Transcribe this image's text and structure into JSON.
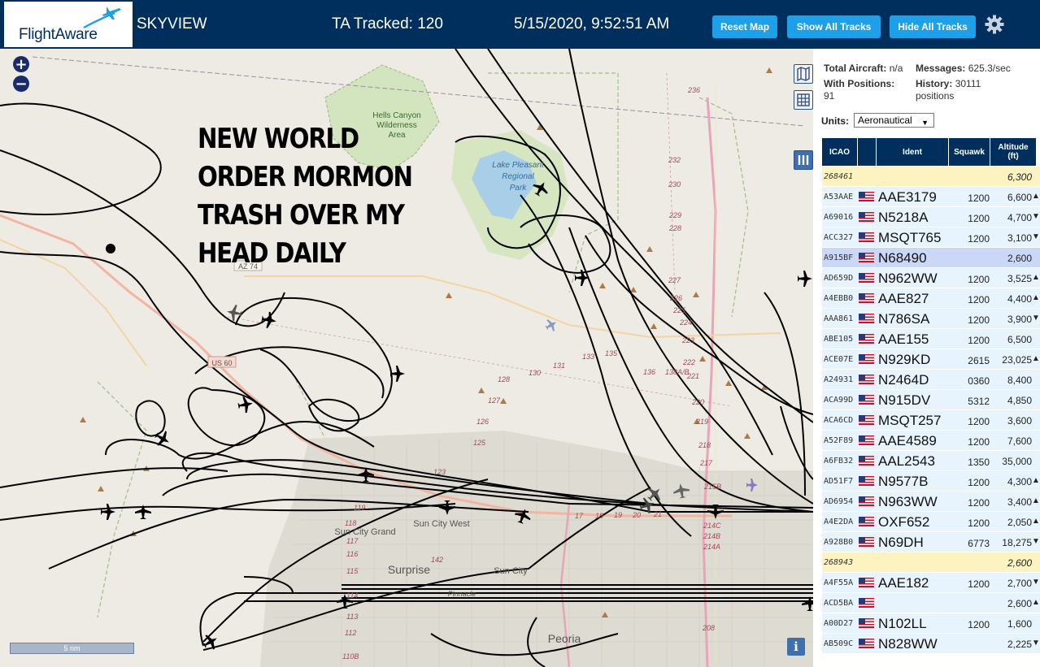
{
  "header": {
    "logo": "FlightAware",
    "app_title": "SKYVIEW",
    "ta_tracked": "TA Tracked: 120",
    "datetime": "5/15/2020, 9:52:51 AM",
    "reset_map": "Reset Map",
    "show_all_tracks": "Show All Tracks",
    "hide_all_tracks": "Hide All Tracks",
    "settings_icon": "gear-icon"
  },
  "map": {
    "zoom_in": "+",
    "zoom_out": "−",
    "overlay_lines": [
      "NEW WORLD",
      "ORDER MORMON",
      "TRASH OVER MY",
      "HEAD DAILY"
    ],
    "scale": "5 nm",
    "info": "i",
    "labels": {
      "hells_canyon": "Hells Canyon",
      "wilderness": "Wilderness",
      "area": "Area",
      "lake_pleasant": "Lake Pleasant",
      "regional": "Regional",
      "park": "Park",
      "az74": "AZ 74",
      "us60": "US 60",
      "sun_city_grand": "Sun City Grand",
      "sun_city_west": "Sun City West",
      "surprise": "Surprise",
      "sun_city": "Sun City",
      "peoria": "Peoria",
      "pinnacle": "Pinnacle"
    },
    "road_numbers": [
      "236",
      "232",
      "230",
      "229",
      "228",
      "227",
      "226",
      "225",
      "224",
      "223",
      "222",
      "221",
      "220",
      "219",
      "218",
      "217",
      "215B",
      "214C",
      "214B",
      "214A",
      "208",
      "142",
      "127",
      "128",
      "130",
      "131",
      "133",
      "135",
      "136",
      "138A/B",
      "123",
      "125",
      "126",
      "119",
      "118",
      "117",
      "116",
      "115",
      "114",
      "113",
      "112",
      "110B",
      "17",
      "18",
      "19",
      "20",
      "21"
    ],
    "colors": {
      "map_bg": "#eeebe4",
      "park": "#cfe5b8",
      "lake": "#a9cfe8",
      "track": "#000000"
    }
  },
  "panel": {
    "total_aircraft_label": "Total Aircraft:",
    "total_aircraft_value": "n/a",
    "messages_label": "Messages:",
    "messages_value": "625.3/sec",
    "with_positions_label": "With Positions:",
    "with_positions_value": "91",
    "history_label": "History:",
    "history_value": "30111",
    "history_unit": "positions",
    "units_label": "Units:",
    "units_value": "Aeronautical",
    "columns": {
      "icao": "ICAO",
      "ident": "Ident",
      "squawk": "Squawk",
      "altitude": "Altitude",
      "altitude_unit": "(ft)"
    },
    "rows": [
      {
        "icao": "268461",
        "ident": "",
        "squawk": "",
        "alt": "6,300",
        "arrow": "",
        "style": "yellow",
        "flag": false
      },
      {
        "icao": "A53AAE",
        "ident": "AAE3179",
        "squawk": "1200",
        "alt": "6,600",
        "arrow": "▲",
        "style": "",
        "flag": true
      },
      {
        "icao": "A69016",
        "ident": "N5218A",
        "squawk": "1200",
        "alt": "4,700",
        "arrow": "▼",
        "style": "",
        "flag": true
      },
      {
        "icao": "ACC327",
        "ident": "MSQT765",
        "squawk": "1200",
        "alt": "3,100",
        "arrow": "▼",
        "style": "",
        "flag": true
      },
      {
        "icao": "A915BF",
        "ident": "N68490",
        "squawk": "",
        "alt": "2,600",
        "arrow": "",
        "style": "sel",
        "flag": true
      },
      {
        "icao": "AD659D",
        "ident": "N962WW",
        "squawk": "1200",
        "alt": "3,525",
        "arrow": "▲",
        "style": "",
        "flag": true
      },
      {
        "icao": "A4EBB0",
        "ident": "AAE827",
        "squawk": "1200",
        "alt": "4,400",
        "arrow": "▲",
        "style": "",
        "flag": true
      },
      {
        "icao": "AAA861",
        "ident": "N786SA",
        "squawk": "1200",
        "alt": "3,900",
        "arrow": "▼",
        "style": "",
        "flag": true
      },
      {
        "icao": "ABE105",
        "ident": "AAE155",
        "squawk": "1200",
        "alt": "6,500",
        "arrow": "",
        "style": "",
        "flag": true
      },
      {
        "icao": "ACE07E",
        "ident": "N929KD",
        "squawk": "2615",
        "alt": "23,025",
        "arrow": "▲",
        "style": "",
        "flag": true
      },
      {
        "icao": "A24931",
        "ident": "N2464D",
        "squawk": "0360",
        "alt": "8,400",
        "arrow": "",
        "style": "",
        "flag": true
      },
      {
        "icao": "ACA99D",
        "ident": "N915DV",
        "squawk": "5312",
        "alt": "4,850",
        "arrow": "",
        "style": "",
        "flag": true
      },
      {
        "icao": "ACA6CD",
        "ident": "MSQT257",
        "squawk": "1200",
        "alt": "3,600",
        "arrow": "",
        "style": "",
        "flag": true
      },
      {
        "icao": "A52F89",
        "ident": "AAE4589",
        "squawk": "1200",
        "alt": "7,600",
        "arrow": "",
        "style": "",
        "flag": true
      },
      {
        "icao": "A6FB32",
        "ident": "AAL2543",
        "squawk": "1350",
        "alt": "35,000",
        "arrow": "",
        "style": "",
        "flag": true
      },
      {
        "icao": "AD51F7",
        "ident": "N9577B",
        "squawk": "1200",
        "alt": "4,300",
        "arrow": "▲",
        "style": "",
        "flag": true
      },
      {
        "icao": "AD6954",
        "ident": "N963WW",
        "squawk": "1200",
        "alt": "3,400",
        "arrow": "▲",
        "style": "",
        "flag": true
      },
      {
        "icao": "A4E2DA",
        "ident": "OXF652",
        "squawk": "1200",
        "alt": "2,050",
        "arrow": "▲",
        "style": "",
        "flag": true
      },
      {
        "icao": "A928B0",
        "ident": "N69DH",
        "squawk": "6773",
        "alt": "18,275",
        "arrow": "▼",
        "style": "",
        "flag": true
      },
      {
        "icao": "268943",
        "ident": "",
        "squawk": "",
        "alt": "2,600",
        "arrow": "",
        "style": "yellow",
        "flag": false
      },
      {
        "icao": "A4F55A",
        "ident": "AAE182",
        "squawk": "1200",
        "alt": "2,700",
        "arrow": "▼",
        "style": "",
        "flag": true
      },
      {
        "icao": "ACD5BA",
        "ident": "",
        "squawk": "",
        "alt": "2,600",
        "arrow": "▲",
        "style": "",
        "flag": true
      },
      {
        "icao": "A00D27",
        "ident": "N102LL",
        "squawk": "1200",
        "alt": "1,600",
        "arrow": "",
        "style": "",
        "flag": true
      },
      {
        "icao": "AB509C",
        "ident": "N828WW",
        "squawk": "",
        "alt": "2,225",
        "arrow": "▼",
        "style": "",
        "flag": true
      }
    ]
  }
}
